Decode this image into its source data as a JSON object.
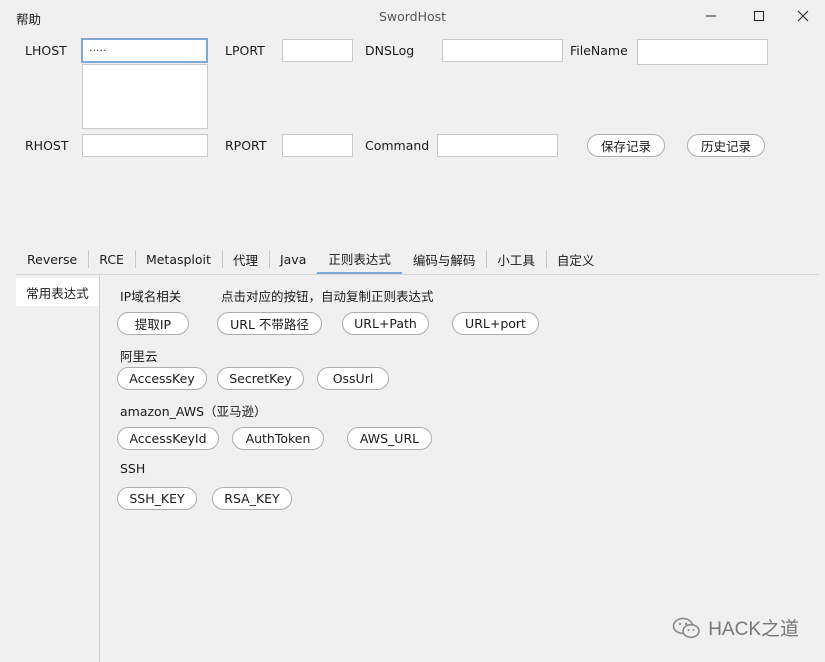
{
  "menu": {
    "help": "帮助"
  },
  "window": {
    "title": "SwordHost"
  },
  "form": {
    "lhost": {
      "label": "LHOST",
      "value": "·····"
    },
    "lport": {
      "label": "LPORT",
      "value": ""
    },
    "dnslog": {
      "label": "DNSLog",
      "value": ""
    },
    "filename": {
      "label": "FileName",
      "value": ""
    },
    "rhost": {
      "label": "RHOST",
      "value": ""
    },
    "rport": {
      "label": "RPORT",
      "value": ""
    },
    "command": {
      "label": "Command",
      "value": ""
    },
    "save_label": "保存记录",
    "history_label": "历史记录"
  },
  "tabs": [
    {
      "label": "Reverse"
    },
    {
      "label": "RCE"
    },
    {
      "label": "Metasploit"
    },
    {
      "label": "代理"
    },
    {
      "label": "Java"
    },
    {
      "label": "正则表达式",
      "active": true
    },
    {
      "label": "编码与解码"
    },
    {
      "label": "小工具"
    },
    {
      "label": "自定义"
    }
  ],
  "sidebar": {
    "item": "常用表达式"
  },
  "regex": {
    "ip_section": "IP域名相关",
    "hint": "点击对应的按钮，自动复制正则表达式",
    "ip_buttons": [
      "提取IP",
      "URL 不带路径",
      "URL+Path",
      "URL+port"
    ],
    "aliyun_section": "阿里云",
    "aliyun_buttons": [
      "AccessKey",
      "SecretKey",
      "OssUrl"
    ],
    "aws_section": "amazon_AWS（亚马逊）",
    "aws_buttons": [
      "AccessKeyId",
      "AuthToken",
      "AWS_URL"
    ],
    "ssh_section": "SSH",
    "ssh_buttons": [
      "SSH_KEY",
      "RSA_KEY"
    ]
  },
  "watermark": {
    "text": "HACK之道"
  },
  "colors": {
    "accent": "#7ea6d6",
    "background": "#f0f0f0"
  }
}
